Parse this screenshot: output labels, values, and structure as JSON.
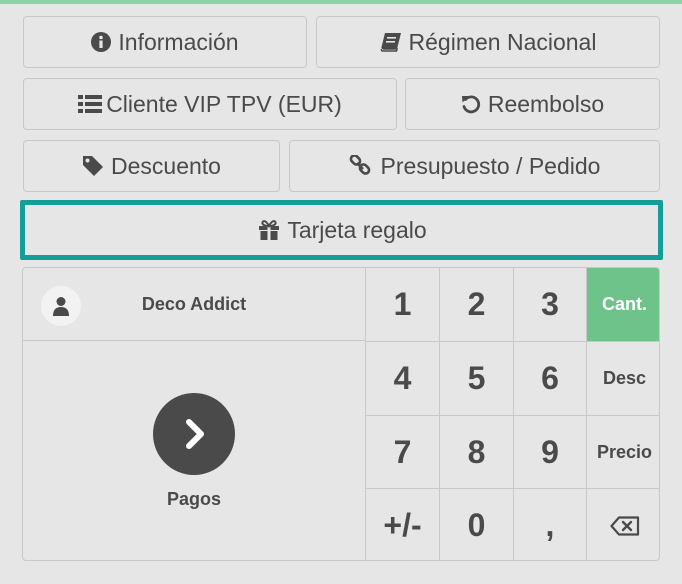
{
  "control_buttons": {
    "info": "Información",
    "fiscal_position": "Régimen Nacional",
    "pricelist": "Cliente VIP TPV (EUR)",
    "refund": "Reembolso",
    "discount": "Descuento",
    "quotation": "Presupuesto / Pedido",
    "gift_card": "Tarjeta regalo"
  },
  "icons": {
    "info": "info-circle-icon",
    "fiscal_position": "book-icon",
    "pricelist": "list-icon",
    "refund": "undo-icon",
    "discount": "tag-icon",
    "quotation": "link-icon",
    "gift_card": "gift-icon",
    "customer": "user-icon",
    "payment": "chevron-right-icon",
    "backspace": "backspace-icon"
  },
  "customer": {
    "name": "Deco Addict"
  },
  "payment": {
    "label": "Pagos"
  },
  "numpad": {
    "keys": [
      "1",
      "2",
      "3",
      "4",
      "5",
      "6",
      "7",
      "8",
      "9",
      "+/-",
      "0",
      ","
    ],
    "modes": {
      "quantity": "Cant.",
      "discount": "Desc",
      "price": "Precio"
    },
    "active_mode": "quantity"
  },
  "colors": {
    "accent_highlight": "#159e97",
    "active_mode_bg": "#6ec38b",
    "background": "#e6e6e6"
  }
}
